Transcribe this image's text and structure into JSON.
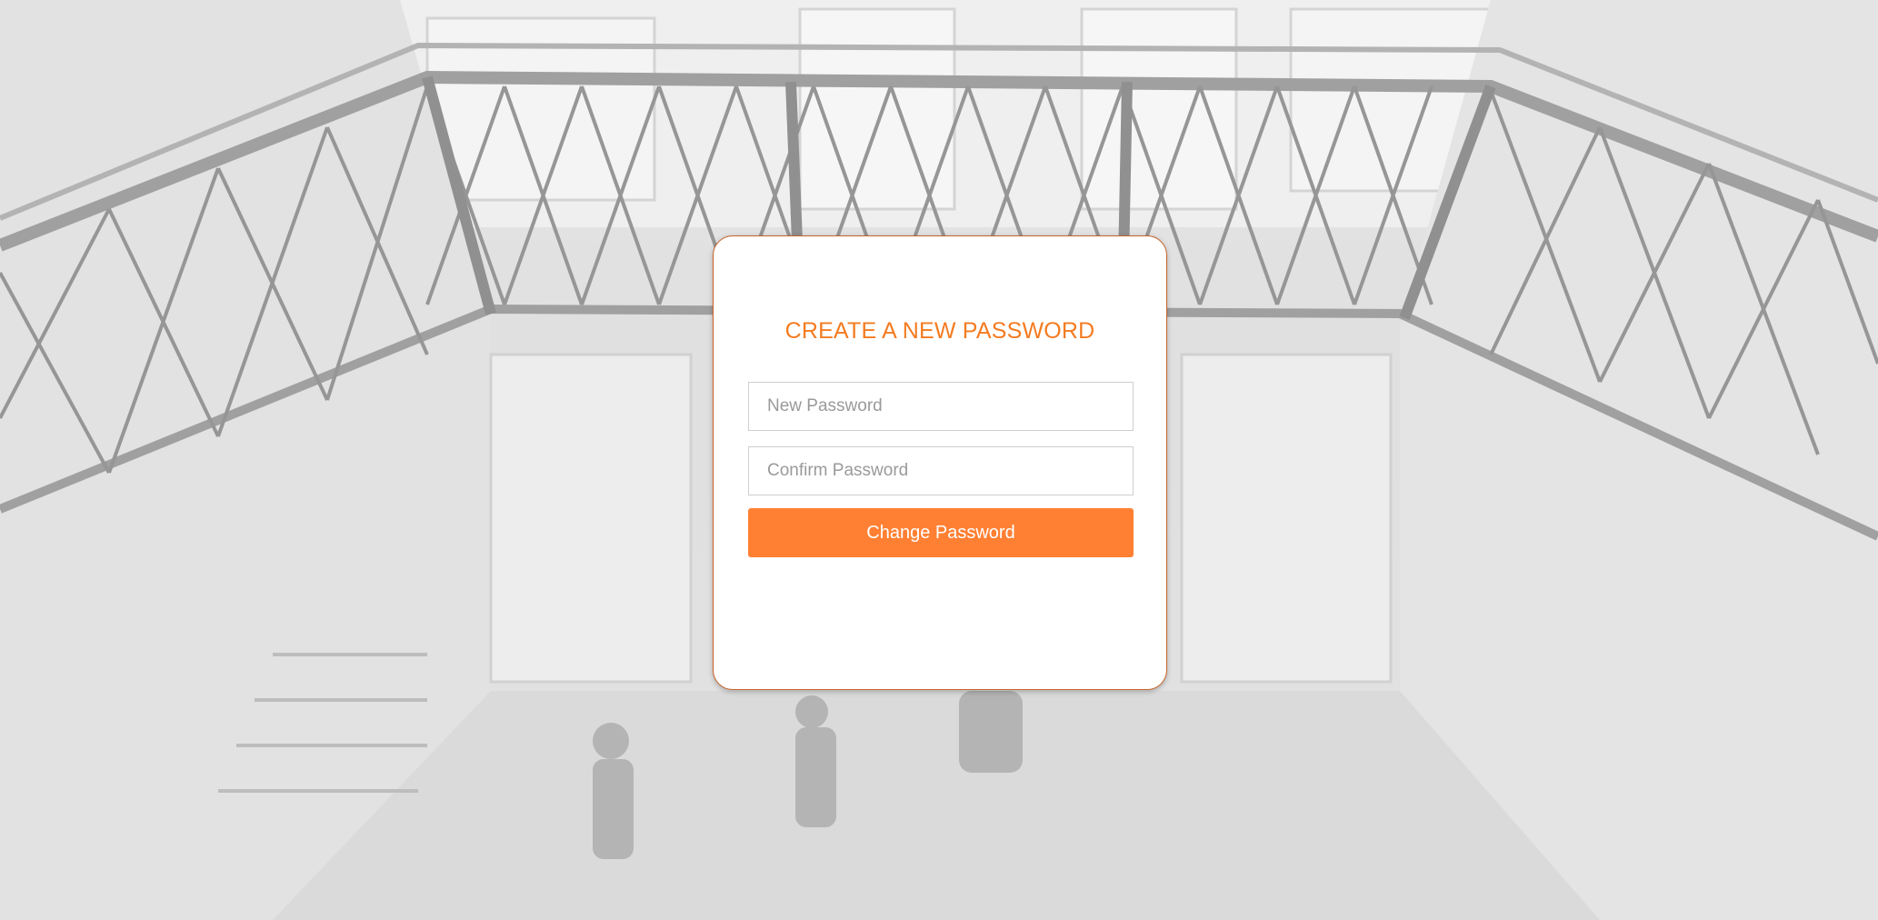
{
  "form": {
    "title": "CREATE A NEW PASSWORD",
    "new_password_placeholder": "New Password",
    "new_password_value": "",
    "confirm_password_placeholder": "Confirm Password",
    "confirm_password_value": "",
    "submit_label": "Change Password"
  },
  "colors": {
    "accent": "#f47b20",
    "button": "#ff8033",
    "card_border": "#c8642a"
  }
}
